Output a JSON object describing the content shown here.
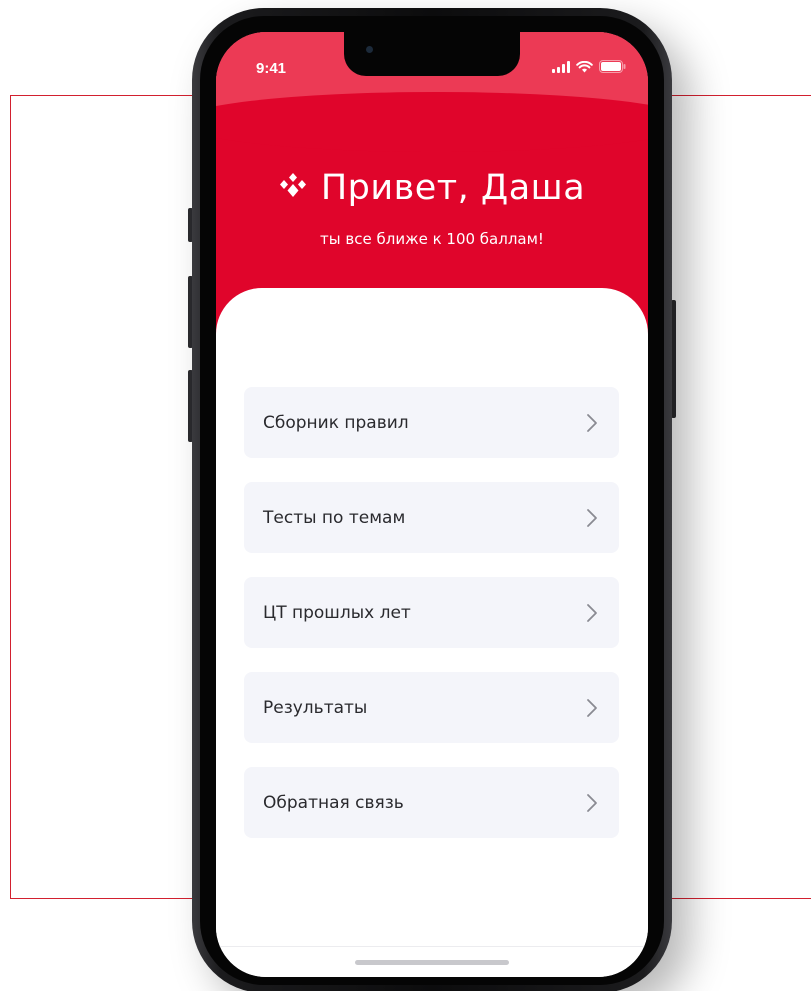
{
  "status_bar": {
    "time": "9:41"
  },
  "header": {
    "greeting": "Привет, Даша",
    "subtitle": "ты все ближе к 100 баллам!",
    "logo_icon": "diamond-logo-icon"
  },
  "menu": {
    "items": [
      {
        "label": "Сборник правил",
        "icon": "chevron-right-icon"
      },
      {
        "label": "Тесты по темам",
        "icon": "chevron-right-icon"
      },
      {
        "label": "ЦТ прошлых лет",
        "icon": "chevron-right-icon"
      },
      {
        "label": "Результаты",
        "icon": "chevron-right-icon"
      },
      {
        "label": "Обратная связь",
        "icon": "chevron-right-icon"
      }
    ]
  },
  "colors": {
    "brand_red": "#e0052b",
    "header_top": "#ec3a55",
    "menu_bg": "#f4f5fa",
    "frame_red": "#d2202f"
  }
}
